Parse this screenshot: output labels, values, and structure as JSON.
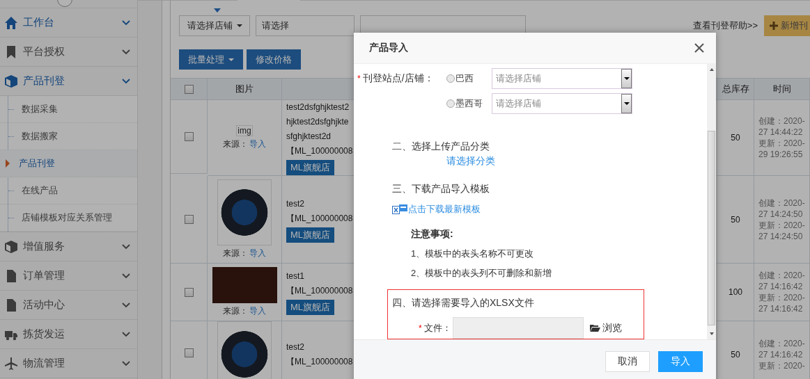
{
  "sidebar": {
    "groups": [
      {
        "label": "工作台",
        "kind": "home",
        "active": true
      },
      {
        "label": "平台授权",
        "kind": "bookmark",
        "active": false
      },
      {
        "label": "产品刊登",
        "kind": "cube",
        "active": true,
        "children": [
          {
            "label": "数据采集",
            "selected": false
          },
          {
            "label": "数据搬家",
            "selected": false
          },
          {
            "label": "产品刊登",
            "selected": true
          },
          {
            "label": "在线产品",
            "selected": false
          },
          {
            "label": "店铺模板对应关系管理",
            "selected": false
          }
        ]
      },
      {
        "label": "增值服务",
        "kind": "cube",
        "active": false
      },
      {
        "label": "订单管理",
        "kind": "file",
        "active": false
      },
      {
        "label": "活动中心",
        "kind": "file",
        "active": false
      },
      {
        "label": "拣货发运",
        "kind": "truck",
        "active": false
      },
      {
        "label": "物流管理",
        "kind": "plane",
        "active": false
      }
    ]
  },
  "toolbar": {
    "store_select": "请选择店铺",
    "select": "请选择",
    "help_link": "查看刊登帮助>>",
    "add_button": "新增刊"
  },
  "actions": [
    {
      "label": "批量处理",
      "dropdown": true
    },
    {
      "label": "修改价格",
      "dropdown": false
    }
  ],
  "table": {
    "header_checked": false,
    "columns": {
      "picture": "图片",
      "stock": "总库存",
      "time": "时间"
    },
    "rows": [
      {
        "checked": false,
        "image": {
          "kind": "broken",
          "alt": "img"
        },
        "source_label": "来源：",
        "source_link": "导入",
        "title_lines": [
          "test2dsfghjktest2",
          "hjktest2dsfghjkte",
          "sfghjktest2d",
          "【ML_100000008"
        ],
        "store_tag": "ML旗舰店",
        "stock": "50",
        "time_lines": [
          "创建：2020-",
          "27 14:44:22",
          "更新：2020-",
          "29 19:26:55"
        ]
      },
      {
        "checked": false,
        "image": {
          "kind": "product"
        },
        "source_label": "来源：",
        "source_link": "导入",
        "title_lines": [
          "test2",
          "【ML_100000008"
        ],
        "store_tag": "ML旗舰店",
        "stock": "50",
        "time_lines": [
          "创建：2020-",
          "27 14:24:50",
          "更新：2020-",
          "27 14:24:50"
        ]
      },
      {
        "checked": false,
        "image": {
          "kind": "portrait"
        },
        "source_label": "来源：",
        "source_link": "导入",
        "title_lines": [
          "test1",
          "【ML_100000008"
        ],
        "store_tag": "ML旗舰店",
        "stock": "100",
        "time_lines": [
          "创建：2020-",
          "27 14:16:42",
          "更新：2020-",
          "27 14:16:42"
        ]
      },
      {
        "checked": false,
        "image": {
          "kind": "product"
        },
        "title_lines": [
          "test2",
          "【ML_100000008"
        ],
        "stock": "50",
        "time_lines": [
          "创建：2020-",
          "27 14:16:42",
          "更新：2020-"
        ]
      }
    ]
  },
  "dialog": {
    "title": "产品导入",
    "required_mark": "*",
    "site_label": "刊登站点/店铺：",
    "sites": [
      {
        "label": "巴西",
        "selected": false,
        "placeholder": "请选择店铺"
      },
      {
        "label": "墨西哥",
        "selected": false,
        "placeholder": "请选择店铺"
      }
    ],
    "step2": {
      "title": "二、选择上传产品分类",
      "link": "请选择分类"
    },
    "step3": {
      "title": "三、下载产品导入模板",
      "link": "点击下载最新模板",
      "notes_title": "注意事项:",
      "notes": [
        "1、模板中的表头名称不可更改",
        "2、模板中的表头列不可删除和新增"
      ]
    },
    "step4": {
      "title": "四、请选择需要导入的XLSX文件",
      "file_label": "文件：",
      "browse": "浏览"
    },
    "buttons": [
      {
        "label": "取消",
        "kind": "secondary"
      },
      {
        "label": "导入",
        "kind": "primary"
      }
    ]
  }
}
